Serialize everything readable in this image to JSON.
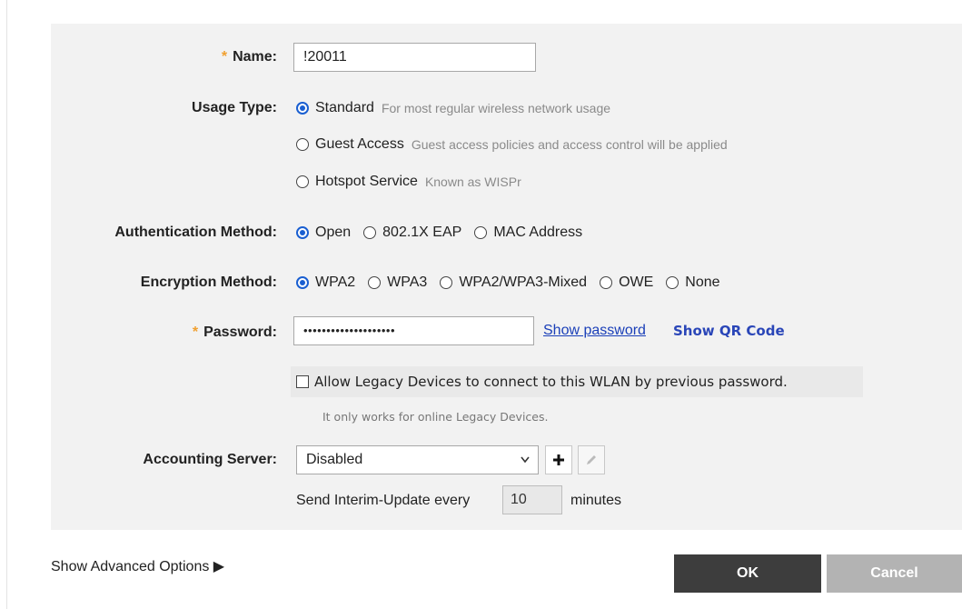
{
  "form": {
    "name": {
      "label": "Name:",
      "required_mark": "*",
      "value": "!20011"
    },
    "usage_type": {
      "label": "Usage Type:",
      "options": [
        {
          "text": "Standard",
          "desc": "For most regular wireless network usage",
          "selected": true
        },
        {
          "text": "Guest Access",
          "desc": "Guest access policies and access control will be applied",
          "selected": false
        },
        {
          "text": "Hotspot Service",
          "desc": "Known as WISPr",
          "selected": false
        }
      ]
    },
    "auth_method": {
      "label": "Authentication Method:",
      "options": [
        {
          "text": "Open",
          "selected": true
        },
        {
          "text": "802.1X EAP",
          "selected": false
        },
        {
          "text": "MAC Address",
          "selected": false
        }
      ]
    },
    "encryption_method": {
      "label": "Encryption Method:",
      "options": [
        {
          "text": "WPA2",
          "selected": true
        },
        {
          "text": "WPA3",
          "selected": false
        },
        {
          "text": "WPA2/WPA3-Mixed",
          "selected": false
        },
        {
          "text": "OWE",
          "selected": false
        },
        {
          "text": "None",
          "selected": false
        }
      ]
    },
    "password": {
      "label": "Password:",
      "required_mark": "*",
      "masked_value": "••••••••••••••••••••",
      "show_password_link": "Show password",
      "show_qr_link": "Show QR Code"
    },
    "legacy": {
      "checkbox_label": "Allow Legacy Devices to connect to this WLAN by previous password.",
      "checked": false,
      "note": "It only works for online Legacy Devices."
    },
    "accounting": {
      "label": "Accounting Server:",
      "selected": "Disabled",
      "interim_prefix": "Send Interim-Update every",
      "interim_value": "10",
      "interim_suffix": "minutes"
    }
  },
  "footer": {
    "advanced_label": "Show Advanced Options ▶",
    "ok_label": "OK",
    "cancel_label": "Cancel"
  },
  "colors": {
    "accent": "#1a5fd1",
    "required": "#f0a030",
    "ok_bg": "#3d3d3d",
    "cancel_bg": "#b3b3b3"
  }
}
